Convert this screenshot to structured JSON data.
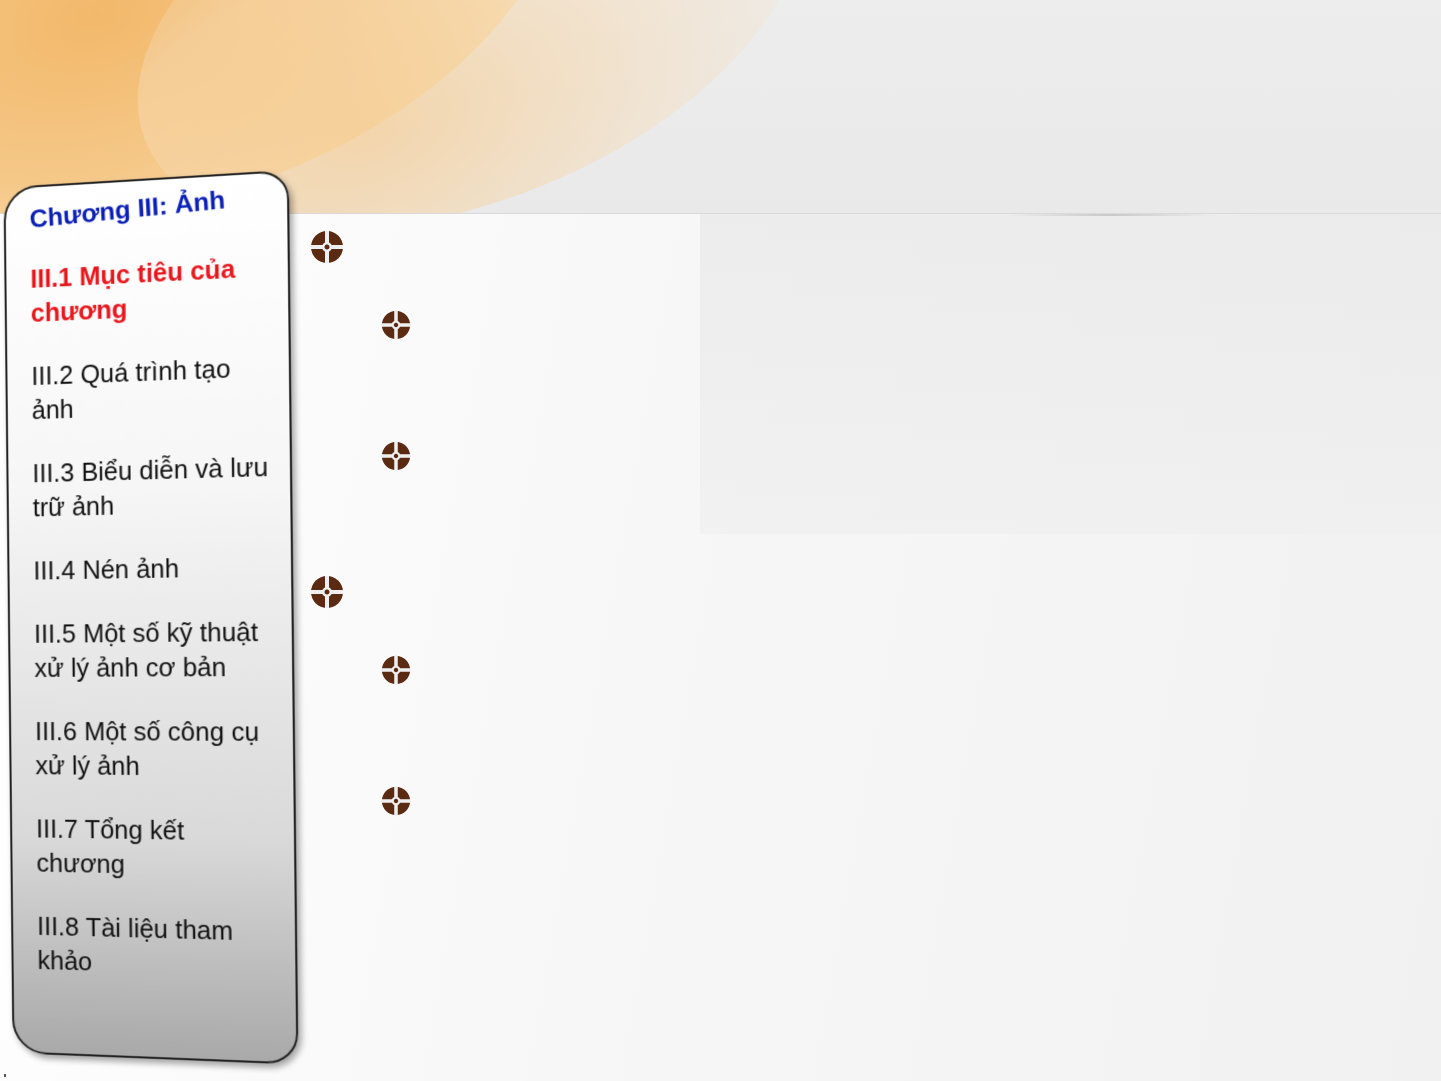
{
  "sidebar": {
    "title": "Chương III: Ảnh",
    "items": [
      {
        "label": "III.1 Mục tiêu của chương",
        "active": true
      },
      {
        "label": "III.2 Quá trình tạo ảnh",
        "active": false
      },
      {
        "label": "III.3 Biểu diễn và lưu trữ ảnh",
        "active": false
      },
      {
        "label": "III.4 Nén ảnh",
        "active": false
      },
      {
        "label": "III.5 Một số kỹ thuật xử lý ảnh cơ bản",
        "active": false
      },
      {
        "label": "III.6 Một số công cụ xử lý ảnh",
        "active": false
      },
      {
        "label": "III.7  Tổng kết chương",
        "active": false
      },
      {
        "label": "III.8 Tài liệu tham khảo",
        "active": false
      }
    ],
    "title_color": "#0a1fb4",
    "active_color": "#e8161c"
  },
  "bullets": {
    "icon": "compass-cross-icon",
    "color": "#5a2a12"
  }
}
